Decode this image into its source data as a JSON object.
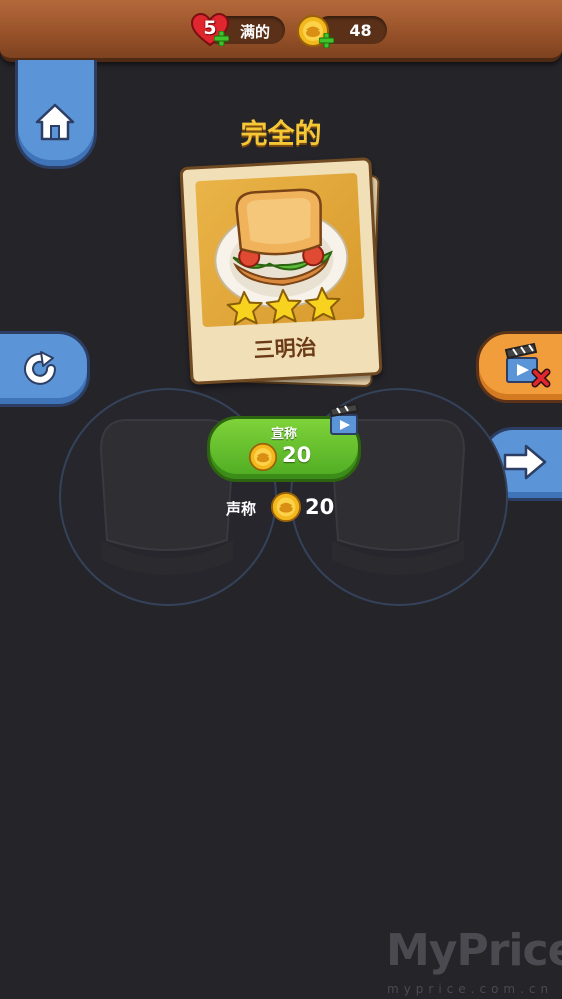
{
  "header": {
    "lives_count": "5",
    "lives_label": "满的",
    "coins_count": "48"
  },
  "title": "完全的",
  "card": {
    "name": "三明治",
    "stars": 3
  },
  "claim_button": {
    "label": "宣称",
    "amount": "20"
  },
  "free_claim": {
    "label": "声称",
    "amount": "20"
  },
  "watermark": {
    "main": "MyPrice",
    "sub": "myprice.com.cn"
  },
  "colors": {
    "gold": "#f6c838",
    "green_button": "#5ec02a",
    "blue_button": "#5c94d8",
    "orange_button": "#f29d3c",
    "background": "#252429"
  }
}
